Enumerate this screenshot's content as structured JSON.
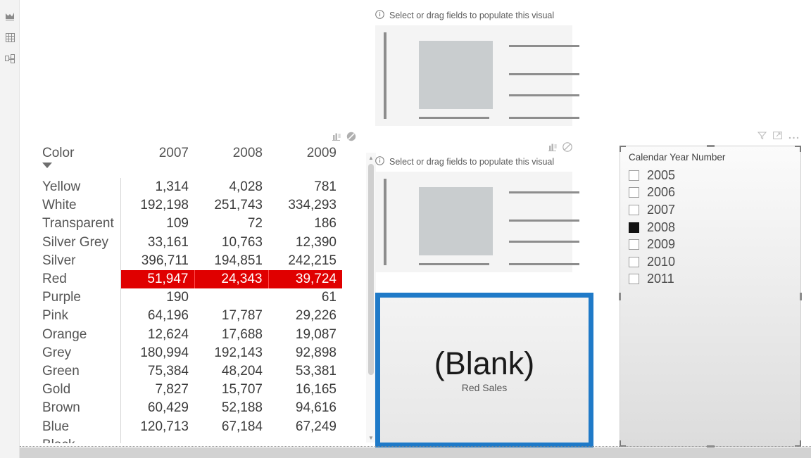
{
  "app": {
    "name": "Power BI Desktop",
    "nav": [
      {
        "name": "report-view",
        "label": "Report view"
      },
      {
        "name": "data-view",
        "label": "Data view"
      },
      {
        "name": "model-view",
        "label": "Model view"
      }
    ]
  },
  "matrix": {
    "name": "color-by-year-matrix",
    "row_header": "Color",
    "columns": [
      "2007",
      "2008",
      "2009"
    ],
    "header_icons": [
      {
        "name": "focus-mode-icon",
        "label": "Focus mode"
      },
      {
        "name": "no-filter-icon",
        "label": "Filters affecting this visual"
      }
    ],
    "rows": [
      {
        "color": "Yellow",
        "values": [
          "1,314",
          "4,028",
          "781"
        ],
        "highlight": false
      },
      {
        "color": "White",
        "values": [
          "192,198",
          "251,743",
          "334,293"
        ],
        "highlight": false
      },
      {
        "color": "Transparent",
        "values": [
          "109",
          "72",
          "186"
        ],
        "highlight": false
      },
      {
        "color": "Silver Grey",
        "values": [
          "33,161",
          "10,763",
          "12,390"
        ],
        "highlight": false
      },
      {
        "color": "Silver",
        "values": [
          "396,711",
          "194,851",
          "242,215"
        ],
        "highlight": false
      },
      {
        "color": "Red",
        "values": [
          "51,947",
          "24,343",
          "39,724"
        ],
        "highlight": true
      },
      {
        "color": "Purple",
        "values": [
          "190",
          "",
          "61"
        ],
        "highlight": false
      },
      {
        "color": "Pink",
        "values": [
          "64,196",
          "17,787",
          "29,226"
        ],
        "highlight": false
      },
      {
        "color": "Orange",
        "values": [
          "12,624",
          "17,688",
          "19,087"
        ],
        "highlight": false
      },
      {
        "color": "Grey",
        "values": [
          "180,994",
          "192,143",
          "92,898"
        ],
        "highlight": false
      },
      {
        "color": "Green",
        "values": [
          "75,384",
          "48,204",
          "53,381"
        ],
        "highlight": false
      },
      {
        "color": "Gold",
        "values": [
          "7,827",
          "15,707",
          "16,165"
        ],
        "highlight": false
      },
      {
        "color": "Brown",
        "values": [
          "60,429",
          "52,188",
          "94,616"
        ],
        "highlight": false
      },
      {
        "color": "Blue",
        "values": [
          "120,713",
          "67,184",
          "67,249"
        ],
        "highlight": false
      },
      {
        "color": "Black",
        "values": [
          "",
          "",
          ""
        ],
        "highlight": false
      }
    ],
    "highlight_color": "#e00000",
    "highlight_text_color": "#ffffff"
  },
  "placeholders": [
    {
      "name": "empty-visual-top",
      "hint": "Select or drag fields to populate this visual",
      "icons": []
    },
    {
      "name": "empty-visual-middle",
      "hint": "Select or drag fields to populate this visual",
      "icons": [
        {
          "name": "focus-mode-icon",
          "label": "Focus mode"
        },
        {
          "name": "no-filter-icon",
          "label": "Filters affecting this visual"
        }
      ]
    }
  ],
  "card": {
    "name": "red-sales-card",
    "value": "(Blank)",
    "label": "Red Sales",
    "selected": true,
    "selection_color": "#1f7ac8"
  },
  "slicer": {
    "name": "calendar-year-slicer",
    "title": "Calendar Year Number",
    "icons": [
      {
        "name": "filter-icon",
        "label": "Filters"
      },
      {
        "name": "focus-mode-icon",
        "label": "Focus mode"
      },
      {
        "name": "more-options-icon",
        "label": "More options"
      }
    ],
    "items": [
      {
        "label": "2005",
        "checked": false
      },
      {
        "label": "2006",
        "checked": false
      },
      {
        "label": "2007",
        "checked": false
      },
      {
        "label": "2008",
        "checked": true
      },
      {
        "label": "2009",
        "checked": false
      },
      {
        "label": "2010",
        "checked": false
      },
      {
        "label": "2011",
        "checked": false
      }
    ]
  }
}
